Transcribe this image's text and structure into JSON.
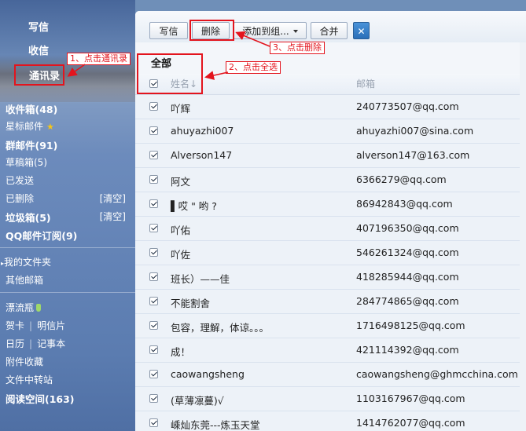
{
  "sidebar": {
    "write_label": "写信",
    "receive_label": "收信",
    "contacts_label": "通讯录",
    "folders": [
      {
        "label": "收件箱(48)",
        "bold": true
      },
      {
        "label": "星标邮件",
        "bold": false
      },
      {
        "label": "群邮件(91)",
        "bold": true
      },
      {
        "label": "草稿箱(5)",
        "bold": false
      },
      {
        "label": "已发送",
        "bold": false
      },
      {
        "label": "已删除",
        "bold": false,
        "action": "[清空]"
      },
      {
        "label": "垃圾箱(5)",
        "bold": true,
        "action": "[清空]"
      },
      {
        "label": "QQ邮件订阅(9)",
        "bold": true
      }
    ],
    "my_folders_label": "我的文件夹",
    "other_mailbox_label": "其他邮箱",
    "drift_bottle_label": "漂流瓶",
    "greeting_card_label": "贺卡",
    "postcard_label": "明信片",
    "calendar_label": "日历",
    "notebook_label": "记事本",
    "attachments_label": "附件收藏",
    "file_transfer_label": "文件中转站",
    "reading_space_label": "阅读空间(163)"
  },
  "toolbar": {
    "write_label": "写信",
    "delete_label": "删除",
    "add_to_group_label": "添加到组...",
    "merge_label": "合并",
    "close_label": "✕"
  },
  "list": {
    "section_title": "全部",
    "col_name": "姓名↓",
    "col_email": "邮箱",
    "contacts": [
      {
        "name": "吖辉",
        "email": "240773507@qq.com"
      },
      {
        "name": "ahuyazhi007",
        "email": "ahuyazhi007@sina.com"
      },
      {
        "name": "Alverson147",
        "email": "alverson147@163.com"
      },
      {
        "name": "阿文",
        "email": "6366279@qq.com"
      },
      {
        "name": "▌哎 \" 哟 ?",
        "email": "86942843@qq.com"
      },
      {
        "name": "吖佑",
        "email": "407196350@qq.com"
      },
      {
        "name": "吖佐",
        "email": "546261324@qq.com"
      },
      {
        "name": "班长）——佳",
        "email": "418285944@qq.com"
      },
      {
        "name": "不能割舍",
        "email": "284774865@qq.com"
      },
      {
        "name": "包容，理解，体谅。。。",
        "email": "1716498125@qq.com"
      },
      {
        "name": "成！",
        "email": "421114392@qq.com"
      },
      {
        "name": "caowangsheng",
        "email": "caowangsheng@ghmcchina.com"
      },
      {
        "name": "(草薄凛蔓)√",
        "email": "1103167967@qq.com"
      },
      {
        "name": "嵊灿东莞---炼玉天堂",
        "email": "1414762077@qq.com"
      }
    ]
  },
  "annotations": {
    "step1": "1、点击通讯录",
    "step2": "2、点击全选",
    "step3": "3、点击删除"
  },
  "colors": {
    "annotation": "#e3141d",
    "sidebar": "#6383b6",
    "row_background": "#edf2f8",
    "close_button": "#2b6fb8"
  }
}
